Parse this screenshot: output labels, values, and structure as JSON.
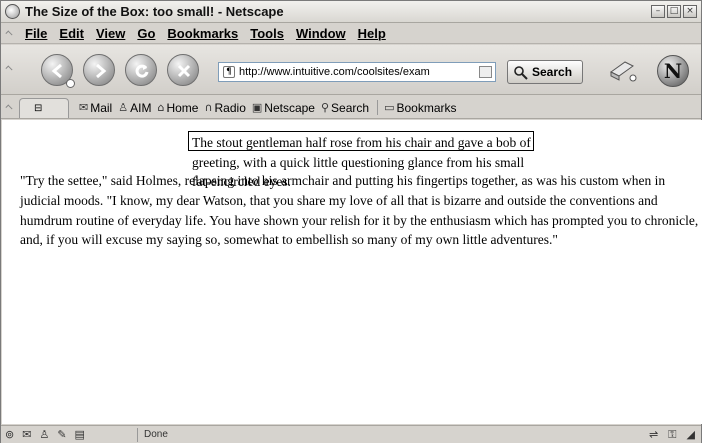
{
  "window": {
    "title": "The Size of the Box: too small! - Netscape",
    "controls": [
      "–",
      "□",
      "×"
    ]
  },
  "menu": {
    "items": [
      "File",
      "Edit",
      "View",
      "Go",
      "Bookmarks",
      "Tools",
      "Window",
      "Help"
    ]
  },
  "nav": {
    "url": "http://www.intuitive.com/coolsites/exam",
    "search_label": "Search",
    "logo_letter": "N"
  },
  "personal_toolbar": {
    "links": [
      "Mail",
      "AIM",
      "Home",
      "Radio",
      "Netscape",
      "Search",
      "Bookmarks"
    ]
  },
  "content": {
    "popup_text": "The stout gentleman half rose from his chair and gave a bob of greeting, with a quick little questioning glance from his small fat-encircled eyes.",
    "paragraph": "\"Try the settee,\" said Holmes, relapsing into his armchair and putting his fingertips together, as was his custom when in judicial moods. \"I know, my dear Watson, that you share my love of all that is bizarre and outside the conventions and humdrum routine of everyday life. You have shown your relish for it by the enthusiasm which has prompted you to chronicle, and, if you will excuse my saying so, somewhat to embellish so many of my own little adventures.\""
  },
  "status": {
    "text": "Done"
  }
}
